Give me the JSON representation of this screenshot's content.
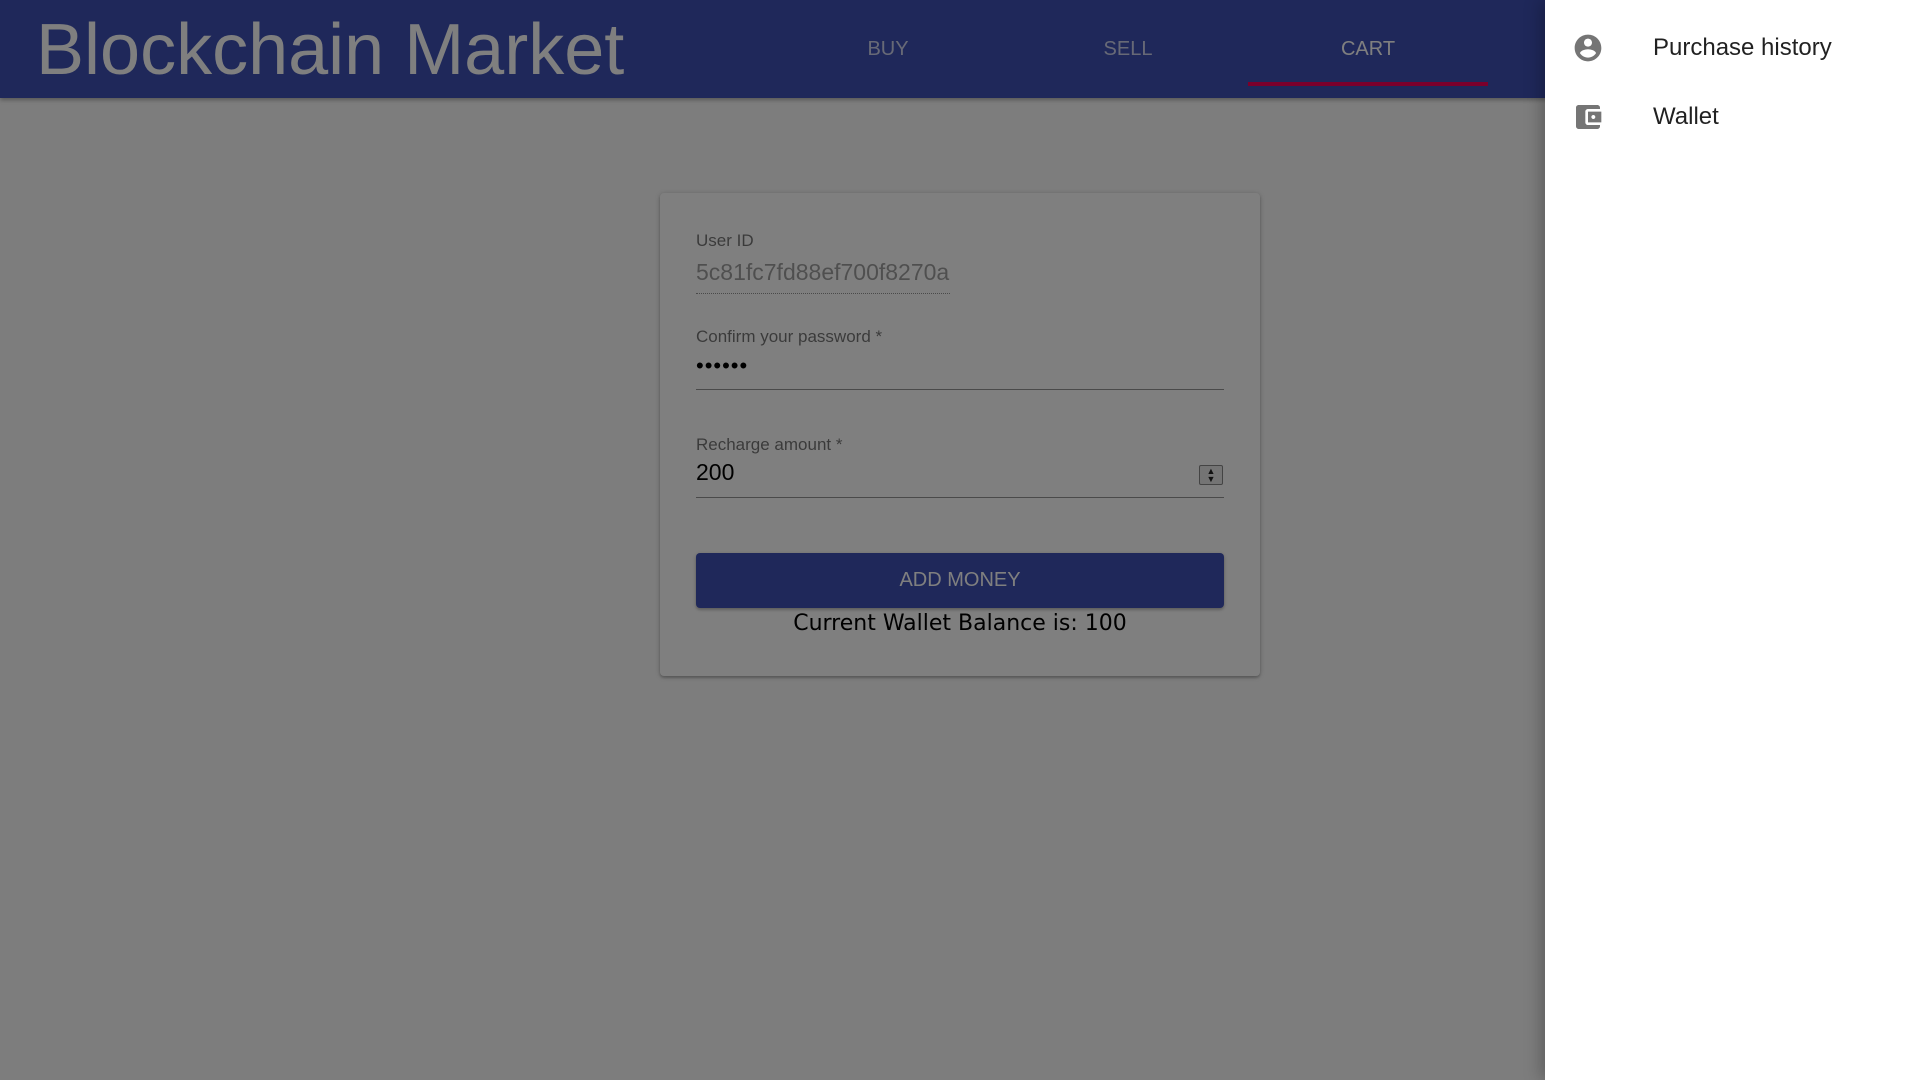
{
  "app": {
    "title": "Blockchain Market"
  },
  "nav": {
    "tabs": [
      {
        "label": "BUY"
      },
      {
        "label": "SELL"
      },
      {
        "label": "CART"
      }
    ],
    "active_tab": "CART"
  },
  "form": {
    "user_id": {
      "label": "User ID",
      "value": "5c81fc7fd88ef700f8270a"
    },
    "password": {
      "label": "Confirm your password *",
      "value": "••••••"
    },
    "recharge": {
      "label": "Recharge amount *",
      "value": "200"
    },
    "submit_label": "ADD MONEY",
    "balance_text": "Current Wallet Balance is: 100"
  },
  "drawer": {
    "items": [
      {
        "label": "Purchase history",
        "icon": "account-circle-icon"
      },
      {
        "label": "Wallet",
        "icon": "wallet-icon"
      }
    ]
  },
  "colors": {
    "primary": "#3f51b5",
    "accent": "#f50057",
    "backdrop": "rgba(0,0,0,0.5)"
  }
}
